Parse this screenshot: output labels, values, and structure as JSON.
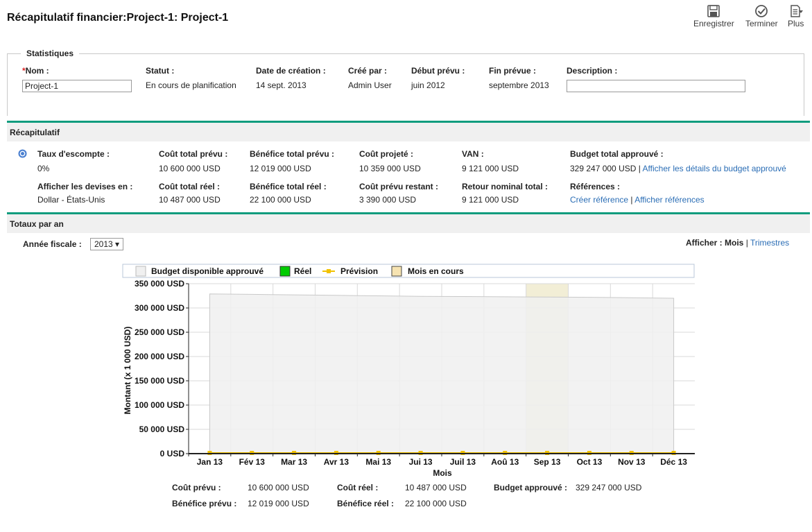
{
  "header": {
    "title": "Récapitulatif financier:Project-1: Project-1",
    "actions": [
      {
        "label": "Enregistrer",
        "icon": "save-icon"
      },
      {
        "label": "Terminer",
        "icon": "check-circle-icon"
      },
      {
        "label": "Plus",
        "icon": "more-menu-icon"
      }
    ]
  },
  "statistics": {
    "legend": "Statistiques",
    "name_label": "Nom :",
    "name_required": "*",
    "name_value": "Project-1",
    "status_label": "Statut :",
    "status_value": "En cours de planification",
    "created_label": "Date de création :",
    "created_value": "14 sept. 2013",
    "created_by_label": "Créé par :",
    "created_by_value": "Admin User",
    "planned_start_label": "Début prévu :",
    "planned_start_value": "juin 2012",
    "planned_end_label": "Fin prévue :",
    "planned_end_value": "septembre 2013",
    "description_label": "Description :",
    "description_value": ""
  },
  "summary": {
    "title": "Récapitulatif",
    "discount_label": "Taux d'escompte :",
    "discount_value": "0%",
    "currency_label": "Afficher les devises en :",
    "currency_value": "Dollar - États-Unis",
    "planned_cost_label": "Coût total prévu :",
    "planned_cost_value": "10 600 000 USD",
    "actual_cost_label": "Coût total réel :",
    "actual_cost_value": "10 487 000 USD",
    "planned_benefit_label": "Bénéfice total prévu :",
    "planned_benefit_value": "12 019 000 USD",
    "actual_benefit_label": "Bénéfice total réel :",
    "actual_benefit_value": "22 100 000 USD",
    "projected_cost_label": "Coût projeté :",
    "projected_cost_value": "10 359 000 USD",
    "remaining_cost_label": "Coût prévu restant :",
    "remaining_cost_value": "3 390 000 USD",
    "npv_label": "VAN :",
    "npv_value": "9 121 000 USD",
    "nominal_return_label": "Retour nominal total :",
    "nominal_return_value": "9 121 000 USD",
    "budget_label": "Budget total approuvé :",
    "budget_value": "329 247 000 USD",
    "budget_sep": "|",
    "budget_link": "Afficher les détails du budget approuvé",
    "references_label": "Références :",
    "create_ref_link": "Créer référence",
    "ref_sep": "|",
    "view_refs_link": "Afficher références"
  },
  "yearly": {
    "title": "Totaux par an",
    "fiscal_year_label": "Année fiscale :",
    "fiscal_year_value": "2013 ▾",
    "view_label": "Afficher :",
    "view_months": "Mois",
    "view_sep": "|",
    "view_quarters": "Trimestres"
  },
  "chart_data": {
    "type": "area",
    "categories": [
      "Jan 13",
      "Fév 13",
      "Mar 13",
      "Avr 13",
      "Mai 13",
      "Jui 13",
      "Juil 13",
      "Aoû 13",
      "Sep 13",
      "Oct 13",
      "Nov 13",
      "Déc 13"
    ],
    "series": [
      {
        "name": "Budget disponible approuvé",
        "type": "area",
        "values": [
          329000,
          328000,
          327000,
          326000,
          325000,
          324000,
          323500,
          323000,
          322500,
          322000,
          321000,
          320000
        ],
        "color": "#f0f0f0"
      },
      {
        "name": "Réel",
        "type": "bar",
        "values": [
          0,
          0,
          0,
          0,
          0,
          0,
          0,
          0,
          0,
          0,
          0,
          0
        ],
        "color": "#00cc00"
      },
      {
        "name": "Prévision",
        "type": "line",
        "values": [
          0,
          0,
          0,
          0,
          0,
          0,
          0,
          0,
          0,
          0,
          0,
          0
        ],
        "color": "#f2c200"
      },
      {
        "name": "Mois en cours",
        "type": "highlight",
        "category": "Sep 13",
        "color": "#f2eed6"
      }
    ],
    "y_ticks": [
      "0 USD",
      "50 000 USD",
      "100 000 USD",
      "150 000 USD",
      "200 000 USD",
      "250 000 USD",
      "300 000 USD",
      "350 000 USD"
    ],
    "ylim": [
      0,
      350000
    ],
    "xlabel": "Mois",
    "ylabel": "Montant (x 1 000 USD)",
    "grid": true,
    "legend": "top"
  },
  "totals": {
    "planned_cost_label": "Coût prévu :",
    "planned_cost_value": "10 600 000 USD",
    "actual_cost_label": "Coût réel :",
    "actual_cost_value": "10 487 000 USD",
    "approved_budget_label": "Budget approuvé :",
    "approved_budget_value": "329 247 000 USD",
    "planned_benefit_label": "Bénéfice prévu :",
    "planned_benefit_value": "12 019 000 USD",
    "actual_benefit_label": "Bénéfice réel :",
    "actual_benefit_value": "22 100 000 USD"
  },
  "colors": {
    "accent": "#0f9c7e",
    "link": "#2a6db5",
    "required": "#dd2222"
  }
}
